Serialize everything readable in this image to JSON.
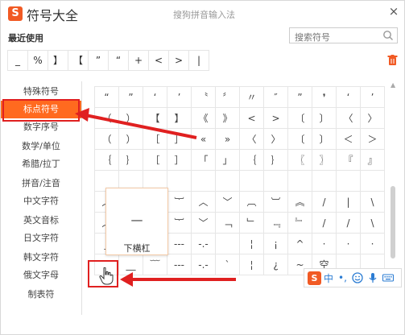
{
  "app": {
    "logo_letter": "S",
    "title": "符号大全",
    "window_title": "搜狗拼音输入法",
    "close_glyph": "×"
  },
  "recent": {
    "label": "最近使用",
    "symbols": [
      "_",
      "%",
      "】",
      "【",
      "”",
      "“",
      "+",
      "<",
      ">",
      "|"
    ]
  },
  "search": {
    "placeholder": "搜索符号"
  },
  "nav": {
    "items": [
      {
        "label": "特殊符号"
      },
      {
        "label": "标点符号",
        "active": true
      },
      {
        "label": "数字序号"
      },
      {
        "label": "数学/单位"
      },
      {
        "label": "希腊/拉丁"
      },
      {
        "label": "拼音/注音"
      },
      {
        "label": "中文字符"
      },
      {
        "label": "英文音标"
      },
      {
        "label": "日文字符"
      },
      {
        "label": "韩文字符"
      },
      {
        "label": "俄文字母"
      },
      {
        "label": "制表符"
      }
    ]
  },
  "grid": {
    "rows": [
      [
        "“",
        "”",
        "‘",
        "’",
        "〝",
        "〞",
        "〃",
        "″",
        "”",
        "❜",
        "‘",
        "’"
      ],
      [
        "（",
        "）",
        "【",
        "】",
        "《",
        "》",
        "<",
        ">",
        "〔",
        "〕",
        "〈",
        "〉"
      ],
      [
        "（",
        "）",
        "［",
        "］",
        "«",
        "»",
        "〈",
        "〉",
        "〔",
        "〕",
        "＜",
        "＞"
      ],
      [
        "｛",
        "｝",
        "［",
        "］",
        "「",
        "」",
        "｛",
        "｝",
        "〖",
        "〗",
        "『",
        "』"
      ],
      [
        "",
        "",
        "",
        "",
        "",
        "",
        "",
        "",
        "",
        "",
        "",
        ""
      ],
      [
        "︵",
        "︶",
        "︷",
        "︸",
        "︿",
        "﹀",
        "︹",
        "︺",
        "︽",
        "/",
        "|",
        "\\"
      ],
      [
        "︵",
        "",
        "︷",
        "︸",
        "﹀",
        "﹁",
        "﹂",
        "﹃",
        "﹄",
        "/",
        "/",
        "\\"
      ],
      [
        "_",
        "—",
        "﹏",
        "---",
        "-.-",
        "",
        "¦",
        "¡",
        "^",
        "·",
        "·",
        "·"
      ],
      [
        "",
        "__",
        "﹋",
        "---",
        "-.-",
        "`",
        "¦",
        "¿",
        "~",
        "空",
        "",
        ""
      ]
    ]
  },
  "tooltip": {
    "symbol": "—",
    "label": "下横杠"
  },
  "ime": {
    "logo_letter": "S",
    "lang": "中",
    "punct": "•,"
  },
  "colors": {
    "accent": "#ff6a1f",
    "highlight": "#e02020"
  }
}
